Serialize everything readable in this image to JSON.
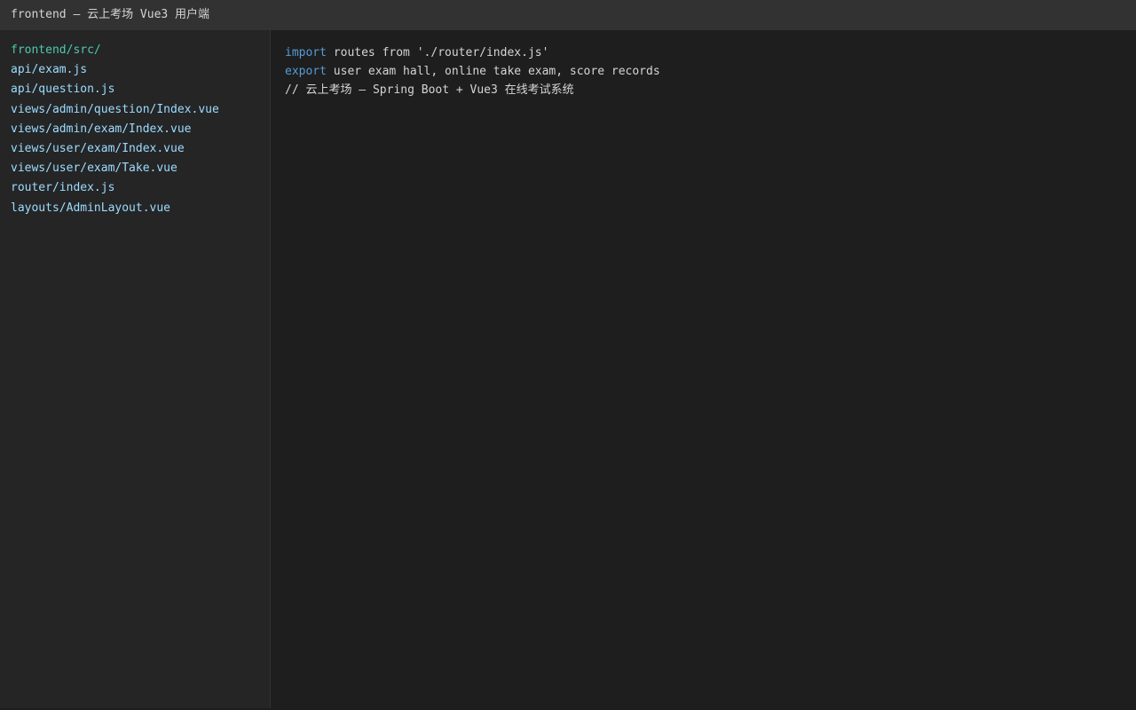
{
  "window": {
    "title": "frontend — 云上考场 Vue3 用户端"
  },
  "sidebar": {
    "root": "frontend/src/",
    "items": [
      {
        "label": "api/exam.js"
      },
      {
        "label": "api/question.js"
      },
      {
        "label": "views/admin/question/Index.vue"
      },
      {
        "label": "views/admin/exam/Index.vue"
      },
      {
        "label": "views/user/exam/Index.vue"
      },
      {
        "label": "views/user/exam/Take.vue"
      },
      {
        "label": "router/index.js"
      },
      {
        "label": "layouts/AdminLayout.vue"
      }
    ]
  },
  "editor": {
    "lines": [
      {
        "keyword": "import",
        "rest": " routes from './router/index.js'"
      },
      {
        "keyword": "export",
        "rest": " user exam hall, online take exam, score records"
      },
      {
        "keyword": "",
        "rest": "// 云上考场 — Spring Boot + Vue3 在线考试系统"
      }
    ]
  },
  "colors": {
    "titlebar_bg": "#323232",
    "sidebar_bg": "#252526",
    "editor_bg": "#1e1e1e",
    "root_folder": "#4ec9b0",
    "file_link": "#9cdcfe",
    "keyword": "#569cd6",
    "text": "#d4d4d4"
  }
}
